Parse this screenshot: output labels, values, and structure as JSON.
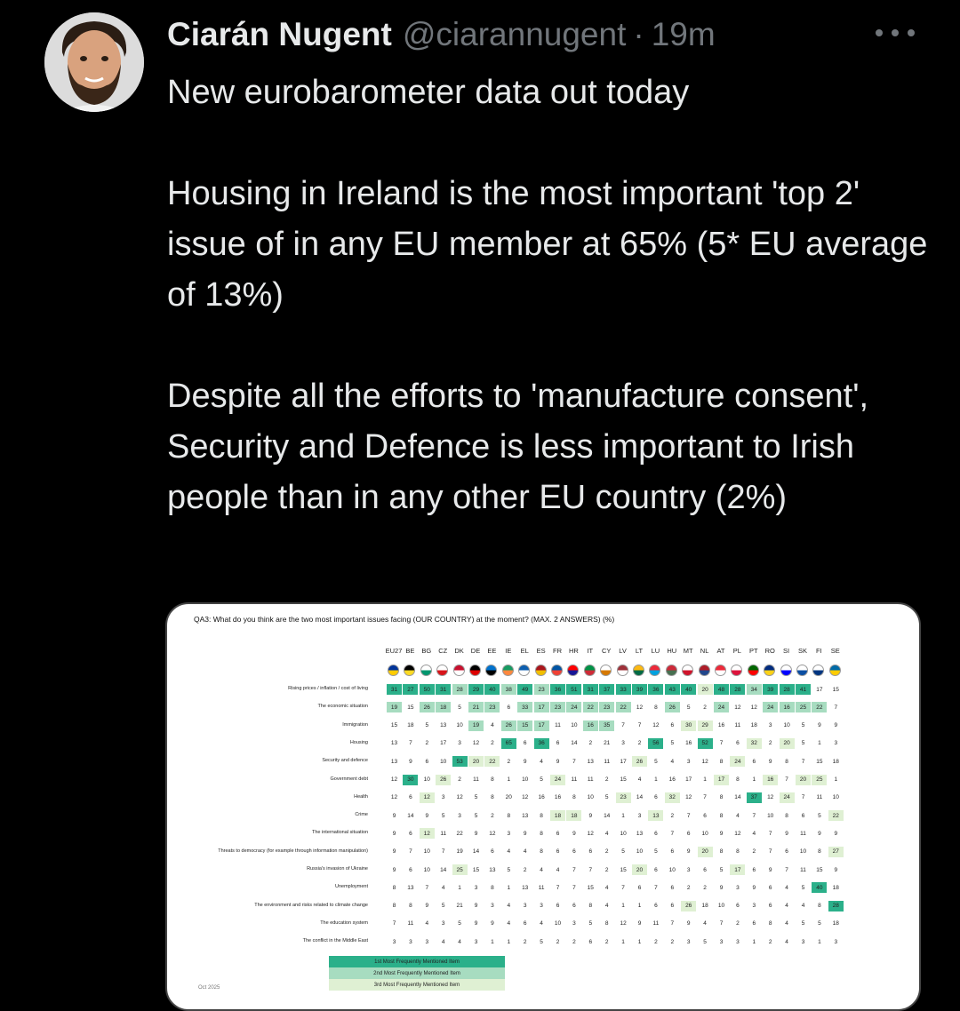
{
  "author": {
    "name": "Ciarán Nugent",
    "handle": "@ciarannugent",
    "separator": "·",
    "time": "19m"
  },
  "tweet": {
    "text": "New eurobarometer data out today\n\nHousing in Ireland is the most important 'top 2' issue of in any EU member at 65% (5* EU average of 13%)\n\nDespite all the efforts to 'manufacture consent', Security and Defence is less important to Irish people than in any other EU country (2%)"
  },
  "media": {
    "question": "QA3: What do you think are the two most important issues facing (OUR COUNTRY) at the moment? (MAX. 2 ANSWERS) (%)",
    "footer_date": "Oct 2025",
    "legend": [
      "1st Most Frequently Mentioned Item",
      "2nd Most Frequently Mentioned Item",
      "3rd Most Frequently Mentioned Item"
    ],
    "colors": {
      "first": "#2bb08a",
      "second": "#a7dcc0",
      "third": "#dff0d3"
    },
    "table": {
      "columns": [
        "EU27",
        "BE",
        "BG",
        "CZ",
        "DK",
        "DE",
        "EE",
        "IE",
        "EL",
        "ES",
        "FR",
        "HR",
        "IT",
        "CY",
        "LV",
        "LT",
        "LU",
        "HU",
        "MT",
        "NL",
        "AT",
        "PL",
        "PT",
        "RO",
        "SI",
        "SK",
        "FI",
        "SE"
      ],
      "rows": [
        {
          "label": "Rising prices / inflation / cost of living",
          "values": [
            31,
            27,
            50,
            31,
            28,
            29,
            40,
            38,
            49,
            23,
            36,
            51,
            31,
            37,
            33,
            39,
            36,
            43,
            40,
            20,
            48,
            28,
            34,
            39,
            28,
            41,
            17,
            15
          ]
        },
        {
          "label": "The economic situation",
          "values": [
            19,
            15,
            26,
            18,
            5,
            21,
            23,
            6,
            33,
            17,
            23,
            24,
            22,
            23,
            22,
            12,
            8,
            26,
            5,
            2,
            24,
            12,
            12,
            24,
            16,
            25,
            22,
            7
          ]
        },
        {
          "label": "Immigration",
          "values": [
            15,
            18,
            5,
            13,
            10,
            19,
            4,
            26,
            15,
            17,
            11,
            10,
            16,
            35,
            7,
            7,
            12,
            6,
            30,
            29,
            16,
            11,
            18,
            3,
            10,
            5,
            9,
            9
          ]
        },
        {
          "label": "Housing",
          "values": [
            13,
            7,
            2,
            17,
            3,
            12,
            2,
            65,
            6,
            36,
            6,
            14,
            2,
            21,
            3,
            2,
            56,
            5,
            16,
            52,
            7,
            6,
            32,
            2,
            20,
            5,
            1,
            3
          ]
        },
        {
          "label": "Security and defence",
          "values": [
            13,
            9,
            6,
            10,
            53,
            20,
            22,
            2,
            9,
            4,
            9,
            7,
            13,
            11,
            17,
            26,
            5,
            4,
            3,
            12,
            8,
            24,
            6,
            9,
            8,
            7,
            15,
            18
          ]
        },
        {
          "label": "Government debt",
          "values": [
            12,
            30,
            10,
            26,
            2,
            11,
            8,
            1,
            10,
            5,
            24,
            11,
            11,
            2,
            15,
            4,
            1,
            16,
            17,
            1,
            17,
            8,
            1,
            16,
            7,
            20,
            25,
            1
          ]
        },
        {
          "label": "Health",
          "values": [
            12,
            6,
            12,
            3,
            12,
            5,
            8,
            20,
            12,
            16,
            16,
            8,
            10,
            5,
            23,
            14,
            6,
            32,
            12,
            7,
            8,
            14,
            37,
            12,
            24,
            7,
            11,
            10
          ]
        },
        {
          "label": "Crime",
          "values": [
            9,
            14,
            9,
            5,
            3,
            5,
            2,
            8,
            13,
            8,
            18,
            18,
            9,
            14,
            1,
            3,
            13,
            2,
            7,
            6,
            8,
            4,
            7,
            10,
            8,
            6,
            5,
            22
          ]
        },
        {
          "label": "The international situation",
          "values": [
            9,
            6,
            12,
            11,
            22,
            9,
            12,
            3,
            9,
            8,
            6,
            9,
            12,
            4,
            10,
            13,
            6,
            7,
            6,
            10,
            9,
            12,
            4,
            7,
            9,
            11,
            9,
            9
          ]
        },
        {
          "label": "Threats to democracy (for example through information manipulation)",
          "values": [
            9,
            7,
            10,
            7,
            19,
            14,
            6,
            4,
            4,
            8,
            6,
            6,
            6,
            2,
            5,
            10,
            5,
            6,
            9,
            20,
            8,
            8,
            2,
            7,
            6,
            10,
            8,
            27
          ]
        },
        {
          "label": "Russia's invasion of Ukraine",
          "values": [
            9,
            6,
            10,
            14,
            25,
            15,
            13,
            5,
            2,
            4,
            4,
            7,
            7,
            2,
            15,
            20,
            6,
            10,
            3,
            6,
            5,
            17,
            6,
            9,
            7,
            11,
            15,
            9
          ]
        },
        {
          "label": "Unemployment",
          "values": [
            8,
            13,
            7,
            4,
            1,
            3,
            8,
            1,
            13,
            11,
            7,
            7,
            15,
            4,
            7,
            6,
            7,
            6,
            2,
            2,
            9,
            3,
            9,
            6,
            4,
            5,
            40,
            18
          ]
        },
        {
          "label": "The environment and risks related to climate change",
          "values": [
            8,
            8,
            9,
            5,
            21,
            9,
            3,
            4,
            3,
            3,
            6,
            6,
            8,
            4,
            1,
            1,
            6,
            6,
            26,
            18,
            10,
            6,
            3,
            6,
            4,
            4,
            8,
            28
          ]
        },
        {
          "label": "The education system",
          "values": [
            7,
            11,
            4,
            3,
            5,
            9,
            9,
            4,
            6,
            4,
            10,
            3,
            5,
            8,
            12,
            9,
            11,
            7,
            9,
            4,
            7,
            2,
            6,
            8,
            4,
            5,
            5,
            18
          ]
        },
        {
          "label": "The conflict in the Middle East",
          "values": [
            3,
            3,
            3,
            4,
            4,
            3,
            1,
            1,
            2,
            5,
            2,
            2,
            6,
            2,
            1,
            1,
            2,
            2,
            3,
            5,
            3,
            3,
            1,
            2,
            4,
            3,
            1,
            3
          ]
        }
      ],
      "highlights": [
        [
          1,
          1,
          1,
          1,
          2,
          1,
          1,
          2,
          1,
          2,
          1,
          1,
          1,
          1,
          1,
          1,
          1,
          1,
          1,
          3,
          1,
          1,
          2,
          1,
          1,
          1,
          0,
          0
        ],
        [
          2,
          0,
          2,
          2,
          0,
          2,
          2,
          0,
          2,
          2,
          2,
          2,
          2,
          2,
          2,
          0,
          0,
          2,
          0,
          0,
          2,
          0,
          0,
          2,
          2,
          2,
          2,
          0
        ],
        [
          0,
          0,
          0,
          0,
          0,
          2,
          0,
          2,
          2,
          2,
          0,
          0,
          2,
          2,
          0,
          0,
          0,
          0,
          3,
          3,
          0,
          0,
          0,
          0,
          0,
          0,
          0,
          0
        ],
        [
          0,
          0,
          0,
          0,
          0,
          0,
          0,
          1,
          0,
          1,
          0,
          0,
          0,
          0,
          0,
          0,
          1,
          0,
          0,
          1,
          0,
          0,
          3,
          0,
          3,
          0,
          0,
          0
        ],
        [
          0,
          0,
          0,
          0,
          1,
          3,
          3,
          0,
          0,
          0,
          0,
          0,
          0,
          0,
          0,
          3,
          0,
          0,
          0,
          0,
          0,
          3,
          0,
          0,
          0,
          0,
          0,
          0
        ],
        [
          0,
          1,
          0,
          3,
          0,
          0,
          0,
          0,
          0,
          0,
          3,
          0,
          0,
          0,
          0,
          0,
          0,
          0,
          0,
          0,
          3,
          0,
          0,
          3,
          0,
          3,
          3,
          0
        ],
        [
          0,
          0,
          3,
          0,
          0,
          0,
          0,
          0,
          0,
          0,
          0,
          0,
          0,
          0,
          3,
          0,
          0,
          3,
          0,
          0,
          0,
          0,
          1,
          0,
          3,
          0,
          0,
          0
        ],
        [
          0,
          0,
          0,
          0,
          0,
          0,
          0,
          0,
          0,
          0,
          3,
          3,
          0,
          0,
          0,
          0,
          3,
          0,
          0,
          0,
          0,
          0,
          0,
          0,
          0,
          0,
          0,
          3
        ],
        [
          0,
          0,
          3,
          0,
          0,
          0,
          0,
          0,
          0,
          0,
          0,
          0,
          0,
          0,
          0,
          0,
          0,
          0,
          0,
          0,
          0,
          0,
          0,
          0,
          0,
          0,
          0,
          0
        ],
        [
          0,
          0,
          0,
          0,
          0,
          0,
          0,
          0,
          0,
          0,
          0,
          0,
          0,
          0,
          0,
          0,
          0,
          0,
          0,
          3,
          0,
          0,
          0,
          0,
          0,
          0,
          0,
          3
        ],
        [
          0,
          0,
          0,
          0,
          3,
          0,
          0,
          0,
          0,
          0,
          0,
          0,
          0,
          0,
          0,
          3,
          0,
          0,
          0,
          0,
          0,
          3,
          0,
          0,
          0,
          0,
          0,
          0
        ],
        [
          0,
          0,
          0,
          0,
          0,
          0,
          0,
          0,
          0,
          0,
          0,
          0,
          0,
          0,
          0,
          0,
          0,
          0,
          0,
          0,
          0,
          0,
          0,
          0,
          0,
          0,
          1,
          0
        ],
        [
          0,
          0,
          0,
          0,
          0,
          0,
          0,
          0,
          0,
          0,
          0,
          0,
          0,
          0,
          0,
          0,
          0,
          0,
          3,
          0,
          0,
          0,
          0,
          0,
          0,
          0,
          0,
          1
        ],
        [
          0,
          0,
          0,
          0,
          0,
          0,
          0,
          0,
          0,
          0,
          0,
          0,
          0,
          0,
          0,
          0,
          0,
          0,
          0,
          0,
          0,
          0,
          0,
          0,
          0,
          0,
          0,
          0
        ],
        [
          0,
          0,
          0,
          0,
          0,
          0,
          0,
          0,
          0,
          0,
          0,
          0,
          0,
          0,
          0,
          0,
          0,
          0,
          0,
          0,
          0,
          0,
          0,
          0,
          0,
          0,
          0,
          0
        ]
      ],
      "flag_colors": [
        [
          "#003399",
          "#ffcc00"
        ],
        [
          "#000000",
          "#fdda24"
        ],
        [
          "#ffffff",
          "#00966e"
        ],
        [
          "#ffffff",
          "#d7141a"
        ],
        [
          "#c8102e",
          "#ffffff"
        ],
        [
          "#000000",
          "#dd0000"
        ],
        [
          "#0072ce",
          "#000000"
        ],
        [
          "#169b62",
          "#ff883e"
        ],
        [
          "#0d5eaf",
          "#ffffff"
        ],
        [
          "#aa151b",
          "#f1bf00"
        ],
        [
          "#0055a4",
          "#ef4135"
        ],
        [
          "#ff0000",
          "#171796"
        ],
        [
          "#009246",
          "#ce2b37"
        ],
        [
          "#ffffff",
          "#d57800"
        ],
        [
          "#9e3039",
          "#ffffff"
        ],
        [
          "#fdb913",
          "#006a44"
        ],
        [
          "#ed2939",
          "#00a1de"
        ],
        [
          "#ce2939",
          "#477050"
        ],
        [
          "#ffffff",
          "#cf142b"
        ],
        [
          "#ae1c28",
          "#21468b"
        ],
        [
          "#ed2939",
          "#ffffff"
        ],
        [
          "#ffffff",
          "#dc143c"
        ],
        [
          "#006600",
          "#ff0000"
        ],
        [
          "#002b7f",
          "#fcd116"
        ],
        [
          "#ffffff",
          "#0000ff"
        ],
        [
          "#ffffff",
          "#0b4ea2"
        ],
        [
          "#ffffff",
          "#003580"
        ],
        [
          "#006aa7",
          "#fecc00"
        ]
      ]
    }
  }
}
